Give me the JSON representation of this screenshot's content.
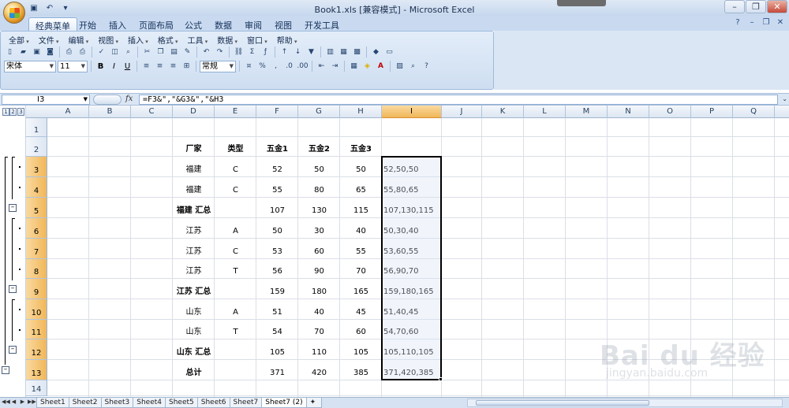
{
  "window": {
    "title": "Book1.xls  [兼容模式] - Microsoft Excel",
    "controls": [
      "–",
      "❐",
      "✕"
    ]
  },
  "qat": [
    "save-icon",
    "undo-icon",
    "dropdown-icon"
  ],
  "ribbon": {
    "tabs": [
      "经典菜单",
      "开始",
      "插入",
      "页面布局",
      "公式",
      "数据",
      "审阅",
      "视图",
      "开发工具"
    ],
    "active_tab": "经典菜单",
    "right_icons": [
      "?",
      "–",
      "❐",
      "✕"
    ]
  },
  "menus": [
    "全部",
    "文件",
    "编辑",
    "视图",
    "插入",
    "格式",
    "工具",
    "数据",
    "窗口",
    "帮助"
  ],
  "format": {
    "font_name": "宋体",
    "font_size": "11",
    "number_format": "常规"
  },
  "formula_bar": {
    "cell_ref": "I3",
    "fx": "fx",
    "formula": "=F3&\",\"&G3&\",\"&H3"
  },
  "outline_levels": [
    "1",
    "2",
    "3"
  ],
  "columns": [
    "A",
    "B",
    "C",
    "D",
    "E",
    "F",
    "G",
    "H",
    "I",
    "J",
    "K",
    "L",
    "M",
    "N",
    "O",
    "P",
    "Q"
  ],
  "active_column": "I",
  "rows": [
    "1",
    "2",
    "3",
    "4",
    "5",
    "6",
    "7",
    "8",
    "9",
    "10",
    "11",
    "12",
    "13",
    "14"
  ],
  "active_rows": [
    "3",
    "4",
    "5",
    "6",
    "7",
    "8",
    "9",
    "10",
    "11",
    "12",
    "13"
  ],
  "table": {
    "headers": {
      "D": "厂家",
      "E": "类型",
      "F": "五金1",
      "G": "五金2",
      "H": "五金3"
    },
    "data_rows": [
      {
        "D": "福建",
        "E": "C",
        "F": "52",
        "G": "50",
        "H": "50",
        "I": "52,50,50",
        "bold": false
      },
      {
        "D": "福建",
        "E": "C",
        "F": "55",
        "G": "80",
        "H": "65",
        "I": "55,80,65",
        "bold": false
      },
      {
        "D": "福建 汇总",
        "E": "",
        "F": "107",
        "G": "130",
        "H": "115",
        "I": "107,130,115",
        "bold": true
      },
      {
        "D": "江苏",
        "E": "A",
        "F": "50",
        "G": "30",
        "H": "40",
        "I": "50,30,40",
        "bold": false
      },
      {
        "D": "江苏",
        "E": "C",
        "F": "53",
        "G": "60",
        "H": "55",
        "I": "53,60,55",
        "bold": false
      },
      {
        "D": "江苏",
        "E": "T",
        "F": "56",
        "G": "90",
        "H": "70",
        "I": "56,90,70",
        "bold": false
      },
      {
        "D": "江苏 汇总",
        "E": "",
        "F": "159",
        "G": "180",
        "H": "165",
        "I": "159,180,165",
        "bold": true
      },
      {
        "D": "山东",
        "E": "A",
        "F": "51",
        "G": "40",
        "H": "45",
        "I": "51,40,45",
        "bold": false
      },
      {
        "D": "山东",
        "E": "T",
        "F": "54",
        "G": "70",
        "H": "60",
        "I": "54,70,60",
        "bold": false
      },
      {
        "D": "山东 汇总",
        "E": "",
        "F": "105",
        "G": "110",
        "H": "105",
        "I": "105,110,105",
        "bold": true
      },
      {
        "D": "总计",
        "E": "",
        "F": "371",
        "G": "420",
        "H": "385",
        "I": "371,420,385",
        "bold": true
      }
    ]
  },
  "sheet_nav": [
    "◀◀",
    "◀",
    "▶",
    "▶▶"
  ],
  "sheets": [
    "Sheet1",
    "Sheet2",
    "Sheet3",
    "Sheet4",
    "Sheet5",
    "Sheet6",
    "Sheet7",
    "Sheet7 (2)"
  ],
  "active_sheet": "Sheet7 (2)",
  "watermark": {
    "brand": "Bai du 经验",
    "url": "jingyan.baidu.com"
  }
}
